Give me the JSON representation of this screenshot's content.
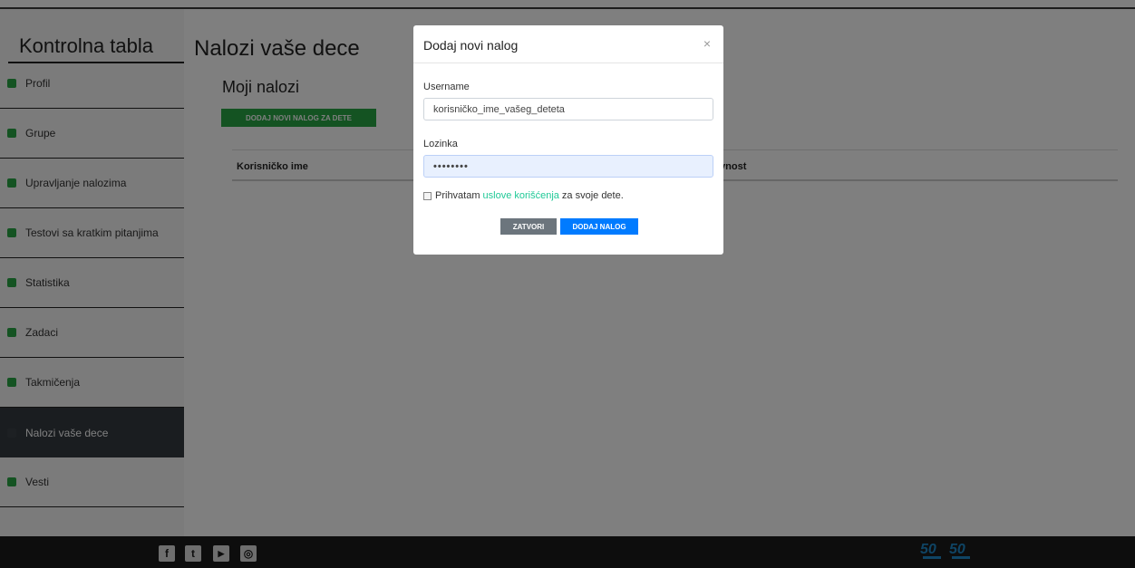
{
  "sidebar": {
    "title": "Kontrolna tabla",
    "items": [
      {
        "label": "Profil",
        "icon": "user-icon",
        "color": "#28a745"
      },
      {
        "label": "Grupe",
        "icon": "users-icon",
        "color": "#28a745"
      },
      {
        "label": "Upravljanje nalozima",
        "icon": "user-plus-icon",
        "color": "#28a745"
      },
      {
        "label": "Testovi sa kratkim pitanjima",
        "icon": "check-square-icon",
        "color": "#28a745"
      },
      {
        "label": "Statistika",
        "icon": "chart-icon",
        "color": "#28a745"
      },
      {
        "label": "Zadaci",
        "icon": "list-icon",
        "color": "#28a745"
      },
      {
        "label": "Takmičenja",
        "icon": "bar-chart-icon",
        "color": "#28a745"
      },
      {
        "label": "Nalozi vaše dece",
        "icon": "child-icon",
        "color": "#28a745",
        "active": true
      },
      {
        "label": "Vesti",
        "icon": "news-icon",
        "color": "#28a745"
      }
    ]
  },
  "main": {
    "title": "Nalozi vaše dece",
    "subtitle": "Moji nalozi",
    "add_button": "DODAJ NOVI NALOG ZA DETE",
    "table_headers": [
      "Korisničko ime",
      "ivnost"
    ]
  },
  "modal": {
    "title": "Dodaj novi nalog",
    "close_symbol": "×",
    "username_label": "Username",
    "username_value": "korisničko_ime_vašeg_deteta",
    "password_label": "Lozinka",
    "password_value": "••••••••",
    "terms_before": "Prihvatam",
    "terms_link": "uslove korišćenja",
    "terms_after": "za svoje dete.",
    "close_button": "ZATVORI",
    "submit_button": "DODAJ NALOG"
  },
  "footer": {
    "social": [
      {
        "icon": "facebook-icon",
        "glyph": "f"
      },
      {
        "icon": "twitter-icon",
        "glyph": "t"
      },
      {
        "icon": "youtube-icon",
        "glyph": "▶"
      },
      {
        "icon": "github-icon",
        "glyph": "◎"
      }
    ],
    "badges": [
      "50",
      "50"
    ]
  },
  "colors": {
    "accent_green": "#28a745",
    "primary_blue": "#007bff",
    "secondary_gray": "#6c757d",
    "link_teal": "#20c997",
    "footer_bg": "#1b1b1b"
  }
}
